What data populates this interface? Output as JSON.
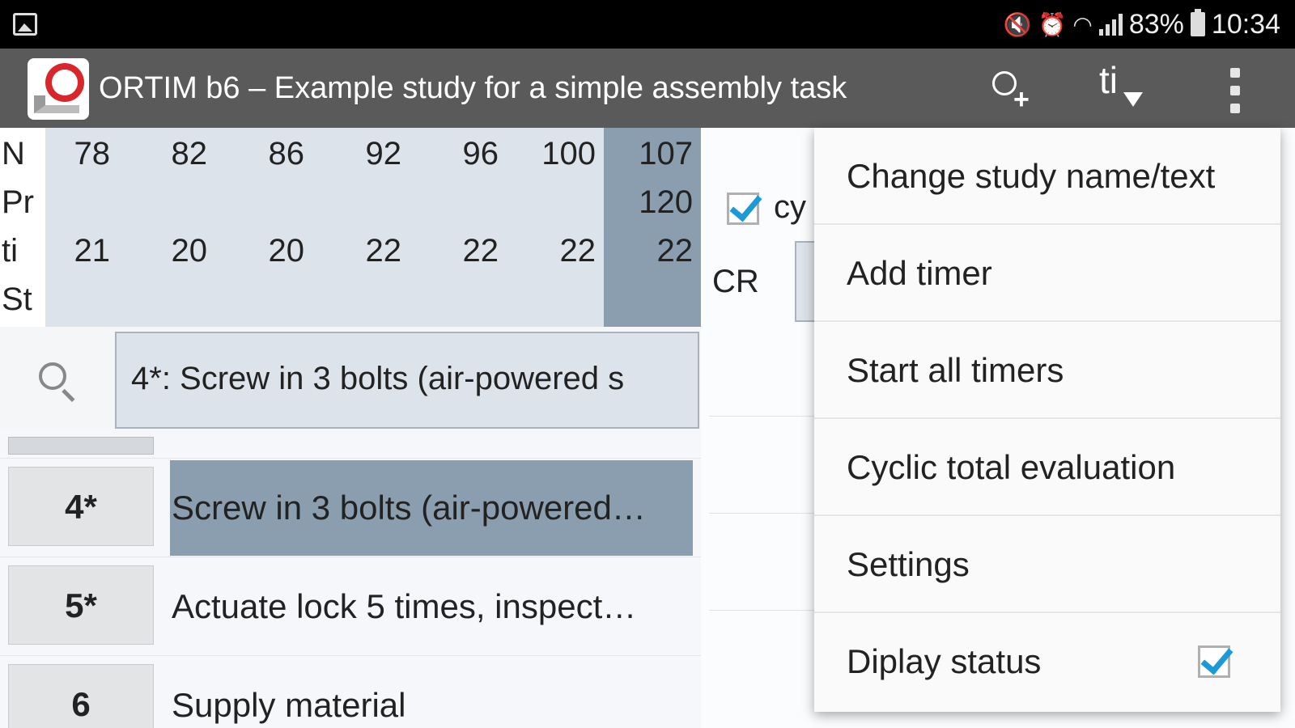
{
  "status_bar": {
    "icons": [
      "gallery-icon",
      "mute-icon",
      "alarm-icon",
      "wifi-icon",
      "signal-icon",
      "battery-icon"
    ],
    "battery": "83%",
    "time": "10:34"
  },
  "app_bar": {
    "title": "ORTIM b6 – Example study for a simple assembly task",
    "ti_label": "ti",
    "icons": [
      "app-logo",
      "add-timer-icon",
      "sort-ti-icon",
      "more-vert-icon"
    ],
    "background": "#5a5a5a"
  },
  "table": {
    "labels": [
      "N",
      "Pr",
      "ti",
      "St"
    ],
    "columns": [
      {
        "N": "78",
        "Pr": "",
        "ti": "21",
        "St": ""
      },
      {
        "N": "82",
        "Pr": "",
        "ti": "20",
        "St": ""
      },
      {
        "N": "86",
        "Pr": "",
        "ti": "20",
        "St": ""
      },
      {
        "N": "92",
        "Pr": "",
        "ti": "22",
        "St": ""
      },
      {
        "N": "96",
        "Pr": "",
        "ti": "22",
        "St": ""
      },
      {
        "N": "100",
        "Pr": "",
        "ti": "22",
        "St": ""
      },
      {
        "N": "107",
        "Pr": "120",
        "ti": "22",
        "St": ""
      }
    ],
    "highlight_color": "#8a9eaf"
  },
  "search": {
    "value": "4*: Screw in 3 bolts (air-powered s"
  },
  "list": [
    {
      "num": "4*",
      "text": "Screw in 3 bolts (air-powered…",
      "selected": true
    },
    {
      "num": "5*",
      "text": "Actuate lock 5 times, inspect…",
      "selected": false
    },
    {
      "num": "6",
      "text": "Supply material",
      "selected": false
    }
  ],
  "right_pane": {
    "cyclic_checkbox_label": "cy",
    "cyclic_checked": true,
    "cr_label": "CR"
  },
  "menu": {
    "items": [
      {
        "label": "Change study name/text"
      },
      {
        "label": "Add timer"
      },
      {
        "label": "Start all timers"
      },
      {
        "label": "Cyclic total evaluation"
      },
      {
        "label": "Settings"
      },
      {
        "label": "Diplay status",
        "checked": true
      }
    ],
    "check_color": "#1a9ad6"
  }
}
